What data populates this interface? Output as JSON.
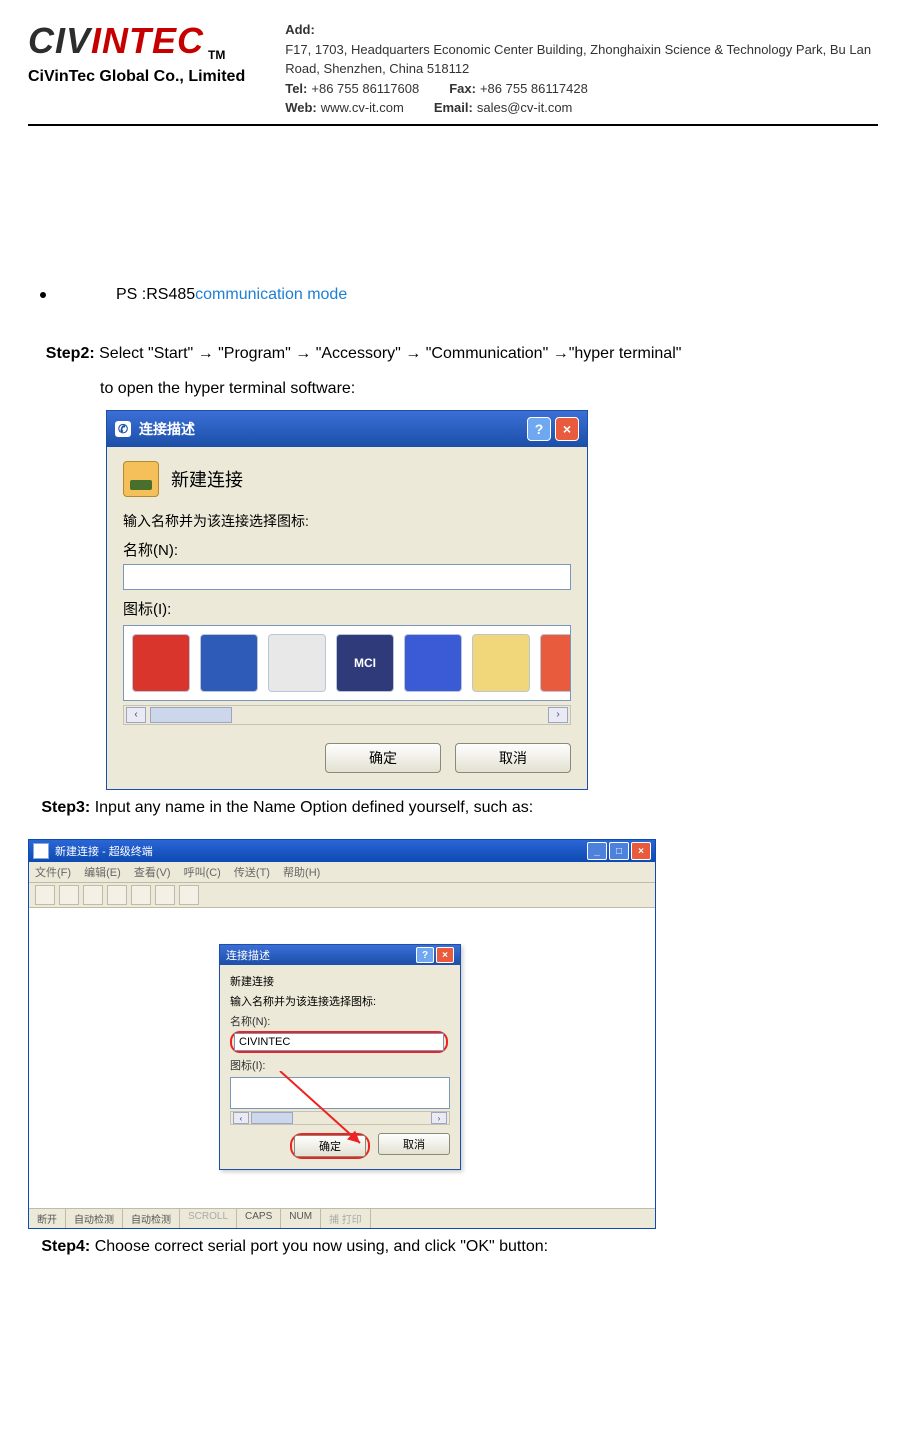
{
  "header": {
    "logo_civ": "CIV",
    "logo_intec": "INTEC",
    "tm": "TM",
    "subtitle": "CiVinTec Global Co., Limited",
    "add_k": "Add:",
    "add_v": "F17, 1703, Headquarters Economic Center Building, Zhonghaixin Science & Technology Park, Bu Lan Road, Shenzhen, China 518112",
    "tel_k": "Tel:",
    "tel_v": "+86 755 86117608",
    "fax_k": "Fax:",
    "fax_v": "+86 755 86117428",
    "web_k": "Web:",
    "web_v": "www.cv-it.com",
    "email_k": "Email:",
    "email_v": "sales@cv-it.com"
  },
  "bullet": {
    "ps": "PS :RS485 ",
    "blue": "communication mode"
  },
  "step2": {
    "label": "Step2:",
    "text": " Select \"Start\" → \"Program\" → \"Accessory\" → \"Communication\" →\"hyper terminal\"",
    "line2": "to open the hyper terminal software:"
  },
  "dlg1": {
    "title": "连接描述",
    "help": "?",
    "close": "×",
    "new_conn": "新建连接",
    "prompt": "输入名称并为该连接选择图标:",
    "name_label": "名称(N):",
    "name_value": "",
    "icon_label": "图标(I):",
    "mci": "MCI",
    "left": "‹",
    "right": "›",
    "ok": "确定",
    "cancel": "取消"
  },
  "step3": {
    "label": "Step3:",
    "text": " Input any name in the Name Option defined yourself, such as:"
  },
  "ht": {
    "title": "新建连接 - 超级终端",
    "min": "_",
    "max": "□",
    "close": "×",
    "menu": {
      "file": "文件(F)",
      "edit": "编辑(E)",
      "view": "查看(V)",
      "call": "呼叫(C)",
      "transfer": "传送(T)",
      "help": "帮助(H)"
    },
    "status": {
      "s1": "断开",
      "s2": "自动检测",
      "s3": "自动检测",
      "s4": "SCROLL",
      "s5": "CAPS",
      "s6": "NUM",
      "s7": "捕 打印"
    }
  },
  "dlg2": {
    "title": "连接描述",
    "help": "?",
    "close": "×",
    "new_conn": "新建连接",
    "prompt": "输入名称并为该连接选择图标:",
    "name_label": "名称(N):",
    "name_value": "CIVINTEC",
    "icon_label": "图标(I):",
    "left": "‹",
    "right": "›",
    "ok": "确定",
    "cancel": "取消"
  },
  "step4": {
    "label": "Step4:",
    "text": " Choose correct serial port you now using, and click \"OK\" button:"
  }
}
